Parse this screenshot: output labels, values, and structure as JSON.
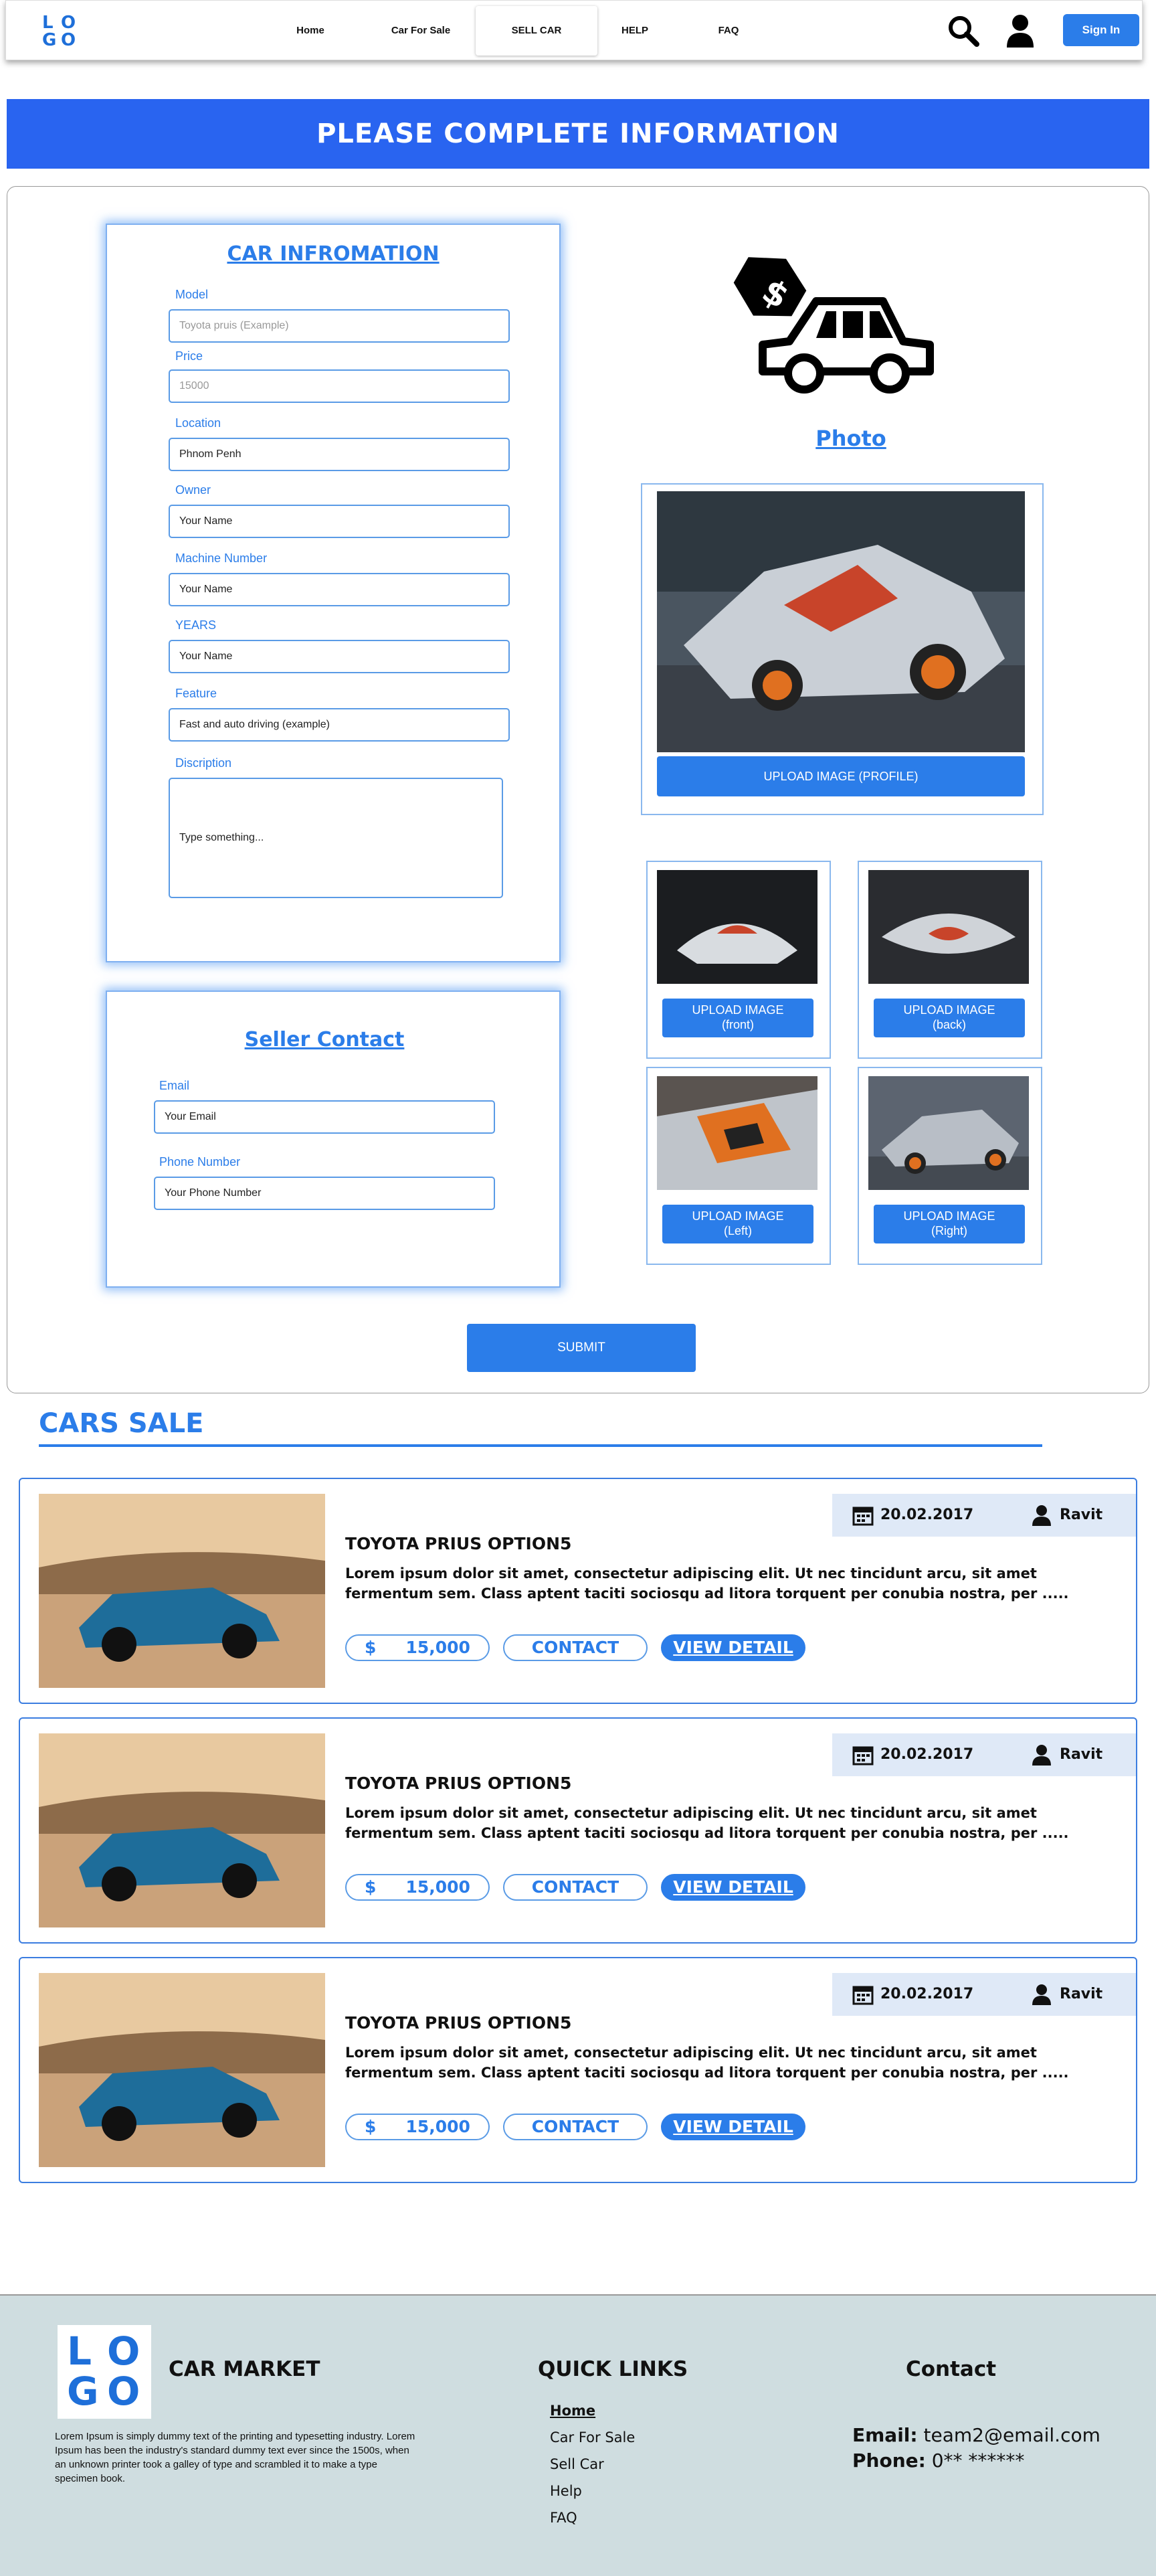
{
  "header": {
    "logo": [
      "L",
      "O",
      "G",
      "O"
    ],
    "nav": [
      "Home",
      "Car For Sale",
      "SELL CAR",
      "HELP",
      "FAQ"
    ],
    "signin": "Sign In"
  },
  "banner": {
    "title": "PLEASE COMPLETE INFORMATION"
  },
  "car_info": {
    "title": "CAR INFROMATION",
    "fields": [
      {
        "label": "Model",
        "placeholder": "Toyota pruis (Example)"
      },
      {
        "label": "Price",
        "placeholder": "15000"
      },
      {
        "label": "Location",
        "value": "Phnom Penh"
      },
      {
        "label": "Owner",
        "value": "Your Name"
      },
      {
        "label": "Machine Number",
        "value": "Your Name"
      },
      {
        "label": "YEARS",
        "value": "Your Name"
      },
      {
        "label": "Feature",
        "value": "Fast and auto driving (example)"
      }
    ],
    "description_label": "Discription",
    "description_value": "Type something..."
  },
  "seller": {
    "title": "Seller Contact",
    "email_label": "Email",
    "email_value": "Your Email",
    "phone_label": "Phone Number",
    "phone_value": "Your Phone Number"
  },
  "photo": {
    "title": "Photo",
    "upload_profile": "UPLOAD IMAGE (PROFILE)",
    "thumbs": [
      {
        "line1": "UPLOAD IMAGE",
        "line2": "(front)"
      },
      {
        "line1": "UPLOAD IMAGE",
        "line2": "(back)"
      },
      {
        "line1": "UPLOAD IMAGE",
        "line2": "(Left)"
      },
      {
        "line1": "UPLOAD IMAGE",
        "line2": "(Right)"
      }
    ]
  },
  "submit": "SUBMIT",
  "cars_sale": {
    "title": "CARS SALE",
    "listings": [
      {
        "date": "20.02.2017",
        "user": "Ravit",
        "title": "TOYOTA PRIUS OPTION5",
        "desc": "Lorem ipsum dolor sit amet, consectetur adipiscing elit. Ut nec tincidunt arcu, sit amet fermentum sem. Class aptent taciti sociosqu ad litora torquent per conubia nostra, per .....",
        "currency": "$",
        "price": "15,000",
        "contact": "CONTACT",
        "detail": "VIEW DETAIL"
      },
      {
        "date": "20.02.2017",
        "user": "Ravit",
        "title": "TOYOTA PRIUS OPTION5",
        "desc": "Lorem ipsum dolor sit amet, consectetur adipiscing elit. Ut nec tincidunt arcu, sit amet fermentum sem. Class aptent taciti sociosqu ad litora torquent per conubia nostra, per .....",
        "currency": "$",
        "price": "15,000",
        "contact": "CONTACT",
        "detail": "VIEW DETAIL"
      },
      {
        "date": "20.02.2017",
        "user": "Ravit",
        "title": "TOYOTA PRIUS OPTION5",
        "desc": "Lorem ipsum dolor sit amet, consectetur adipiscing elit. Ut nec tincidunt arcu, sit amet fermentum sem. Class aptent taciti sociosqu ad litora torquent per conubia nostra, per .....",
        "currency": "$",
        "price": "15,000",
        "contact": "CONTACT",
        "detail": "VIEW DETAIL"
      }
    ]
  },
  "footer": {
    "brand": "CAR MARKET",
    "about": "Lorem Ipsum is simply dummy text of the printing and typesetting industry. Lorem Ipsum has been the industry's standard dummy text ever since the 1500s, when an unknown printer took a galley of type and scrambled it to make a type specimen book.",
    "quick_title": "QUICK LINKS",
    "links": [
      "Home",
      "Car For Sale",
      "Sell Car",
      "Help",
      "FAQ"
    ],
    "contact_title": "Contact",
    "email_label": "Email:",
    "email": "team2@email.com",
    "phone_label": "Phone:",
    "phone": "0** ******"
  },
  "colors": {
    "accent": "#2b7de9",
    "banner": "#2964f0",
    "footer_bg": "#cfdde0"
  }
}
